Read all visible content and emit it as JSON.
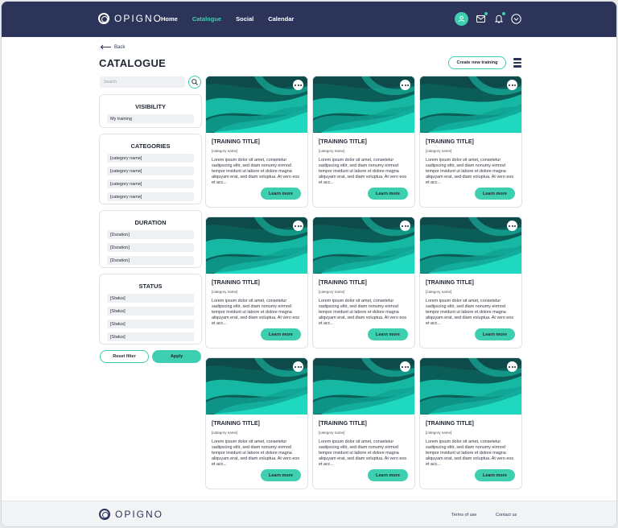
{
  "brand": {
    "name": "OPIGNO",
    "accent": "#3ecfb0",
    "header_bg": "#2c3559"
  },
  "nav": {
    "items": [
      "Home",
      "Catalogue",
      "Social",
      "Calendar"
    ],
    "active": "Catalogue"
  },
  "header_icons": [
    "user-avatar-icon",
    "mail-icon",
    "bell-icon",
    "chevron-down-icon"
  ],
  "page": {
    "back_label": "Back",
    "title": "CATALOGUE",
    "create_label": "Create new training"
  },
  "search": {
    "placeholder": "Search"
  },
  "filters": [
    {
      "title": "VISIBILITY",
      "items": [
        "My training"
      ]
    },
    {
      "title": "CATEGORIES",
      "items": [
        "[category name]",
        "[category name]",
        "[category name]",
        "[category name]"
      ]
    },
    {
      "title": "DURATION",
      "items": [
        "[Duration]",
        "[Duration]",
        "[Duration]"
      ]
    },
    {
      "title": "STATUS",
      "items": [
        "[Status]",
        "[Status]",
        "[Status]",
        "[Status]"
      ]
    }
  ],
  "buttons": {
    "reset": "Reset filter",
    "apply": "Apply"
  },
  "cards": [
    {
      "title": "[TRAINING TITLE]",
      "category": "[category name]",
      "description": "Lorem ipsum dolor sit amet, consetetur sadipscing elitr, sed diam nonumy eirmod tempor invidunt ut labore et dolore magna aliquyam erat, sed diam voluptua. At vero eos et acc...",
      "button": "Learn more"
    },
    {
      "title": "[TRAINING TITLE]",
      "category": "[category name]",
      "description": "Lorem ipsum dolor sit amet, consetetur sadipscing elitr, sed diam nonumy eirmod tempor invidunt ut labore et dolore magna aliquyam erat, sed diam voluptua. At vero eos et acc...",
      "button": "Learn more"
    },
    {
      "title": "[TRAINING TITLE]",
      "category": "[category name]",
      "description": "Lorem ipsum dolor sit amet, consetetur sadipscing elitr, sed diam nonumy eirmod tempor invidunt ut labore et dolore magna aliquyam erat, sed diam voluptua. At vero eos et acc...",
      "button": "Learn more"
    },
    {
      "title": "[TRAINING TITLE]",
      "category": "[category name]",
      "description": "Lorem ipsum dolor sit amet, consetetur sadipscing elitr, sed diam nonumy eirmod tempor invidunt ut labore et dolore magna aliquyam erat, sed diam voluptua. At vero eos et acc...",
      "button": "Learn more"
    },
    {
      "title": "[TRAINING TITLE]",
      "category": "[category name]",
      "description": "Lorem ipsum dolor sit amet, consetetur sadipscing elitr, sed diam nonumy eirmod tempor invidunt ut labore et dolore magna aliquyam erat, sed diam voluptua. At vero eos et acc...",
      "button": "Learn more"
    },
    {
      "title": "[TRAINING TITLE]",
      "category": "[category name]",
      "description": "Lorem ipsum dolor sit amet, consetetur sadipscing elitr, sed diam nonumy eirmod tempor invidunt ut labore et dolore magna aliquyam erat, sed diam voluptua. At vero eos et acc...",
      "button": "Learn more"
    },
    {
      "title": "[TRAINING TITLE]",
      "category": "[category name]",
      "description": "Lorem ipsum dolor sit amet, consetetur sadipscing elitr, sed diam nonumy eirmod tempor invidunt ut labore et dolore magna aliquyam erat, sed diam voluptua. At vero eos et acc...",
      "button": "Learn more"
    },
    {
      "title": "[TRAINING TITLE]",
      "category": "[category name]",
      "description": "Lorem ipsum dolor sit amet, consetetur sadipscing elitr, sed diam nonumy eirmod tempor invidunt ut labore et dolore magna aliquyam erat, sed diam voluptua. At vero eos et acc...",
      "button": "Learn more"
    },
    {
      "title": "[TRAINING TITLE]",
      "category": "[category name]",
      "description": "Lorem ipsum dolor sit amet, consetetur sadipscing elitr, sed diam nonumy eirmod tempor invidunt ut labore et dolore magna aliquyam erat, sed diam voluptua. At vero eos et acc...",
      "button": "Learn more"
    }
  ],
  "footer": {
    "brand": "OPIGNO",
    "links": [
      "Terms of use",
      "Contact us"
    ]
  }
}
